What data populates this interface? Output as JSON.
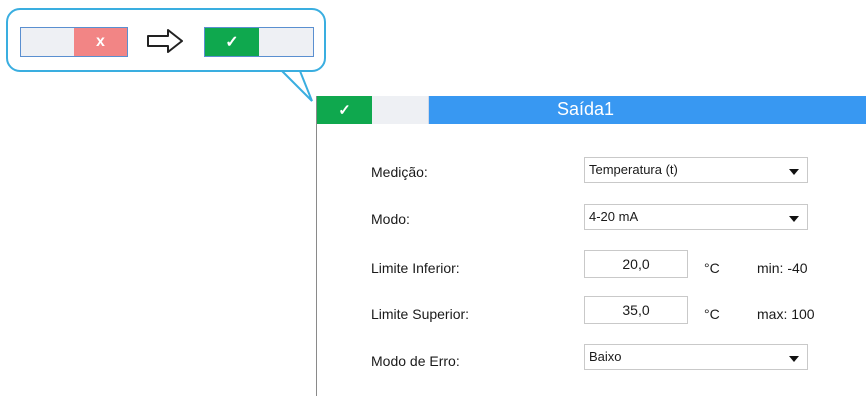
{
  "callout": {
    "toggle_before": {
      "state": "off",
      "icon": "x-icon",
      "glyph": "x",
      "color_active": "#f28585"
    },
    "transition_icon": "right-arrow-icon",
    "toggle_after": {
      "state": "on",
      "icon": "check-icon",
      "glyph": "✓",
      "color_active": "#0fa84e"
    }
  },
  "window": {
    "title": "Saída1",
    "enabled_toggle": {
      "state": "on",
      "glyph": "✓"
    },
    "title_color": "#3898f2"
  },
  "form": {
    "medicao": {
      "label": "Medição:",
      "value": "Temperatura (t)"
    },
    "modo": {
      "label": "Modo:",
      "value": "4-20 mA"
    },
    "limite_inferior": {
      "label": "Limite Inferior:",
      "value": "20,0",
      "unit": "°C",
      "range": "min: -40"
    },
    "limite_superior": {
      "label": "Limite Superior:",
      "value": "35,0",
      "unit": "°C",
      "range": "max: 100"
    },
    "modo_erro": {
      "label": "Modo de Erro:",
      "value": "Baixo"
    }
  }
}
